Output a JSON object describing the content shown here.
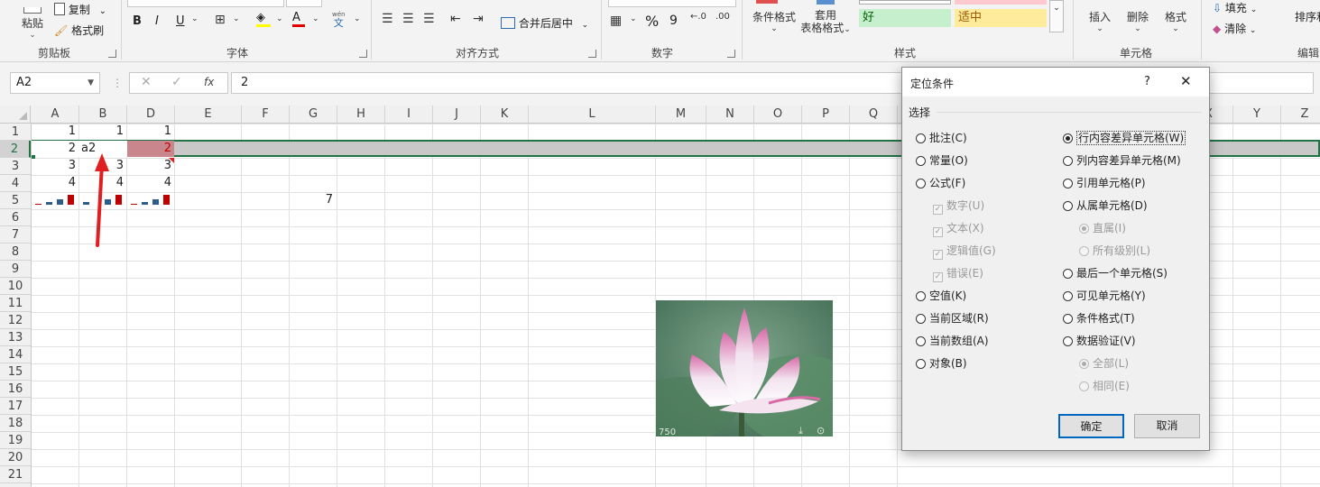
{
  "ribbon": {
    "clipboard": {
      "paste": "粘贴",
      "copy": "复制",
      "format_painter": "格式刷",
      "group": "剪贴板"
    },
    "font": {
      "bold": "B",
      "italic": "I",
      "underline": "U",
      "font_color": "A",
      "wen": "wén",
      "wen_char": "文",
      "group": "字体"
    },
    "align": {
      "merge": "合并后居中",
      "group": "对齐方式"
    },
    "number": {
      "percent": "%",
      "comma": "9",
      "group": "数字"
    },
    "styles": {
      "cond_format": "条件格式",
      "table_format": "套用\n表格格式",
      "table_format_l1": "套用",
      "table_format_l2": "表格格式",
      "good": "好",
      "neutral": "适中",
      "group": "样式",
      "good_bg": "#c6efce",
      "good_fg": "#006100",
      "neutral_bg": "#ffeb9c",
      "neutral_fg": "#9c5700"
    },
    "cells": {
      "insert": "插入",
      "delete": "删除",
      "format": "格式",
      "group": "单元格"
    },
    "editing": {
      "fill": "填充",
      "clear": "清除",
      "sort": "排序和",
      "group": "编辑"
    }
  },
  "formula_bar": {
    "name_box": "A2",
    "value": "2",
    "fx": "fx"
  },
  "columns": [
    "A",
    "B",
    "D",
    "E",
    "F",
    "G",
    "H",
    "I",
    "J",
    "K",
    "L",
    "M",
    "N",
    "O",
    "P",
    "Q",
    "X",
    "Y",
    "Z"
  ],
  "rows": [
    "1",
    "2",
    "3",
    "4",
    "5",
    "6",
    "7",
    "8",
    "9",
    "10",
    "11",
    "12",
    "13",
    "14",
    "15",
    "16",
    "17",
    "18",
    "19",
    "20",
    "21"
  ],
  "cells": {
    "a1": "1",
    "b1": "1",
    "d1": "1",
    "a2": "2",
    "b2": "a2",
    "d2": "2",
    "a3": "3",
    "b3": "3",
    "d3": "3",
    "a4": "4",
    "b4": "4",
    "d4": "4",
    "g5": "7"
  },
  "image": {
    "watermark": "750"
  },
  "dialog": {
    "title": "定位条件",
    "help": "?",
    "close": "✕",
    "section": "选择",
    "left": [
      "批注(C)",
      "常量(O)",
      "公式(F)"
    ],
    "formula_sub": [
      "数字(U)",
      "文本(X)",
      "逻辑值(G)",
      "错误(E)"
    ],
    "left2": [
      "空值(K)",
      "当前区域(R)",
      "当前数组(A)",
      "对象(B)"
    ],
    "right": [
      "行内容差异单元格(W)",
      "列内容差异单元格(M)",
      "引用单元格(P)",
      "从属单元格(D)"
    ],
    "dep_sub": [
      "直属(I)",
      "所有级别(L)"
    ],
    "right2": [
      "最后一个单元格(S)",
      "可见单元格(Y)",
      "条件格式(T)",
      "数据验证(V)"
    ],
    "dv_sub": [
      "全部(L)",
      "相同(E)"
    ],
    "ok": "确定",
    "cancel": "取消",
    "selected": "行内容差异单元格(W)"
  },
  "colors": {
    "accent_green": "#217346",
    "arrow_red": "#e02020",
    "diff_cell": "#c9868d",
    "selection_row": "#c8c8c8"
  }
}
